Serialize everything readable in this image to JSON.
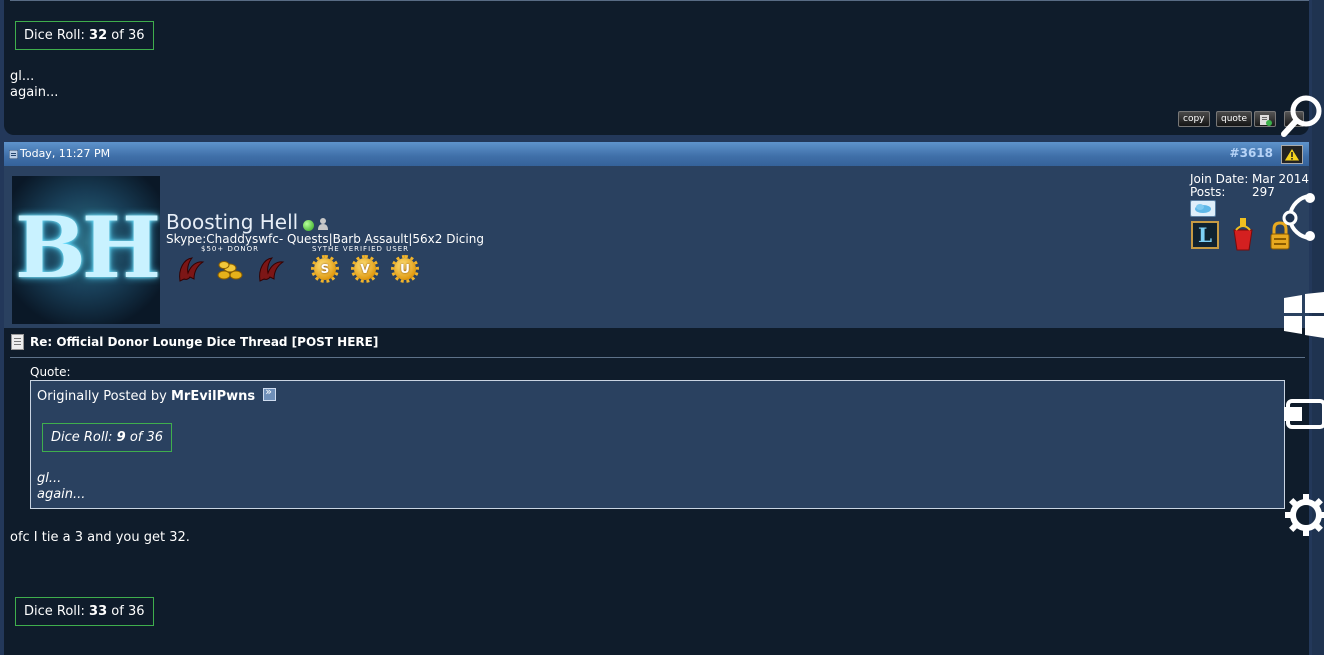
{
  "previous_post": {
    "dice_roll": {
      "label": "Dice Roll:",
      "value": "32",
      "of_text": "of 36"
    },
    "message_lines": [
      "gl...",
      "again..."
    ],
    "buttons": {
      "copy": "copy",
      "quote": "quote"
    }
  },
  "post_header": {
    "date": "Today, 11:27 PM",
    "post_number": "#3618"
  },
  "user": {
    "avatar_text": "BH",
    "username": "Boosting Hell",
    "user_title": "Skype:Chaddyswfc- Quests|Barb Assault|56x2 Dicing",
    "donor_label": "$50+ DONOR",
    "verified_label": "SYTHE VERIFIED USER",
    "medals": [
      "S",
      "V",
      "U"
    ],
    "join_date_label": "Join Date:",
    "join_date": "Mar 2014",
    "posts_label": "Posts:",
    "posts": "297",
    "badge_letter": "L"
  },
  "post": {
    "title": "Re: Official Donor Lounge Dice Thread [POST HERE]",
    "quote_label": "Quote:",
    "quote": {
      "originally_posted_by": "Originally Posted by",
      "author": "MrEvilPwns",
      "dice_roll": {
        "label": "Dice Roll:",
        "value": "9",
        "of_text": "of 36"
      },
      "lines": [
        "gl...",
        "again..."
      ]
    },
    "message": "ofc I tie a 3 and you get 32.",
    "dice_roll": {
      "label": "Dice Roll:",
      "value": "33",
      "of_text": "of 36"
    }
  },
  "side_icons": [
    "search-icon",
    "share-icon",
    "windows-icon",
    "devices-icon",
    "settings-icon"
  ],
  "colors": {
    "dark_bg": "#0f1c2b",
    "panel_bg": "#2a4160",
    "header_blue": "#3f6fa8",
    "dice_border": "#3fae4d"
  }
}
